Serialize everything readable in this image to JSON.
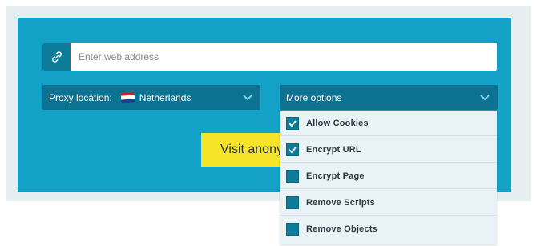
{
  "url_bar": {
    "icon": "link-icon",
    "placeholder": "Enter web address"
  },
  "proxy_location": {
    "label": "Proxy location:",
    "flag_icon": "netherlands-flag-icon",
    "country": "Netherlands"
  },
  "more_options": {
    "label": "More options",
    "options": [
      {
        "label": "Allow Cookies",
        "checked": true
      },
      {
        "label": "Encrypt URL",
        "checked": true
      },
      {
        "label": "Encrypt Page",
        "checked": false
      },
      {
        "label": "Remove Scripts",
        "checked": false
      },
      {
        "label": "Remove Objects",
        "checked": false
      }
    ]
  },
  "visit_button": {
    "label": "Visit anonymously"
  },
  "colors": {
    "panel": "#13a1c8",
    "dark_accent": "#0c7291",
    "button": "#f6e428",
    "dropdown_bg": "#e9f2f4"
  }
}
